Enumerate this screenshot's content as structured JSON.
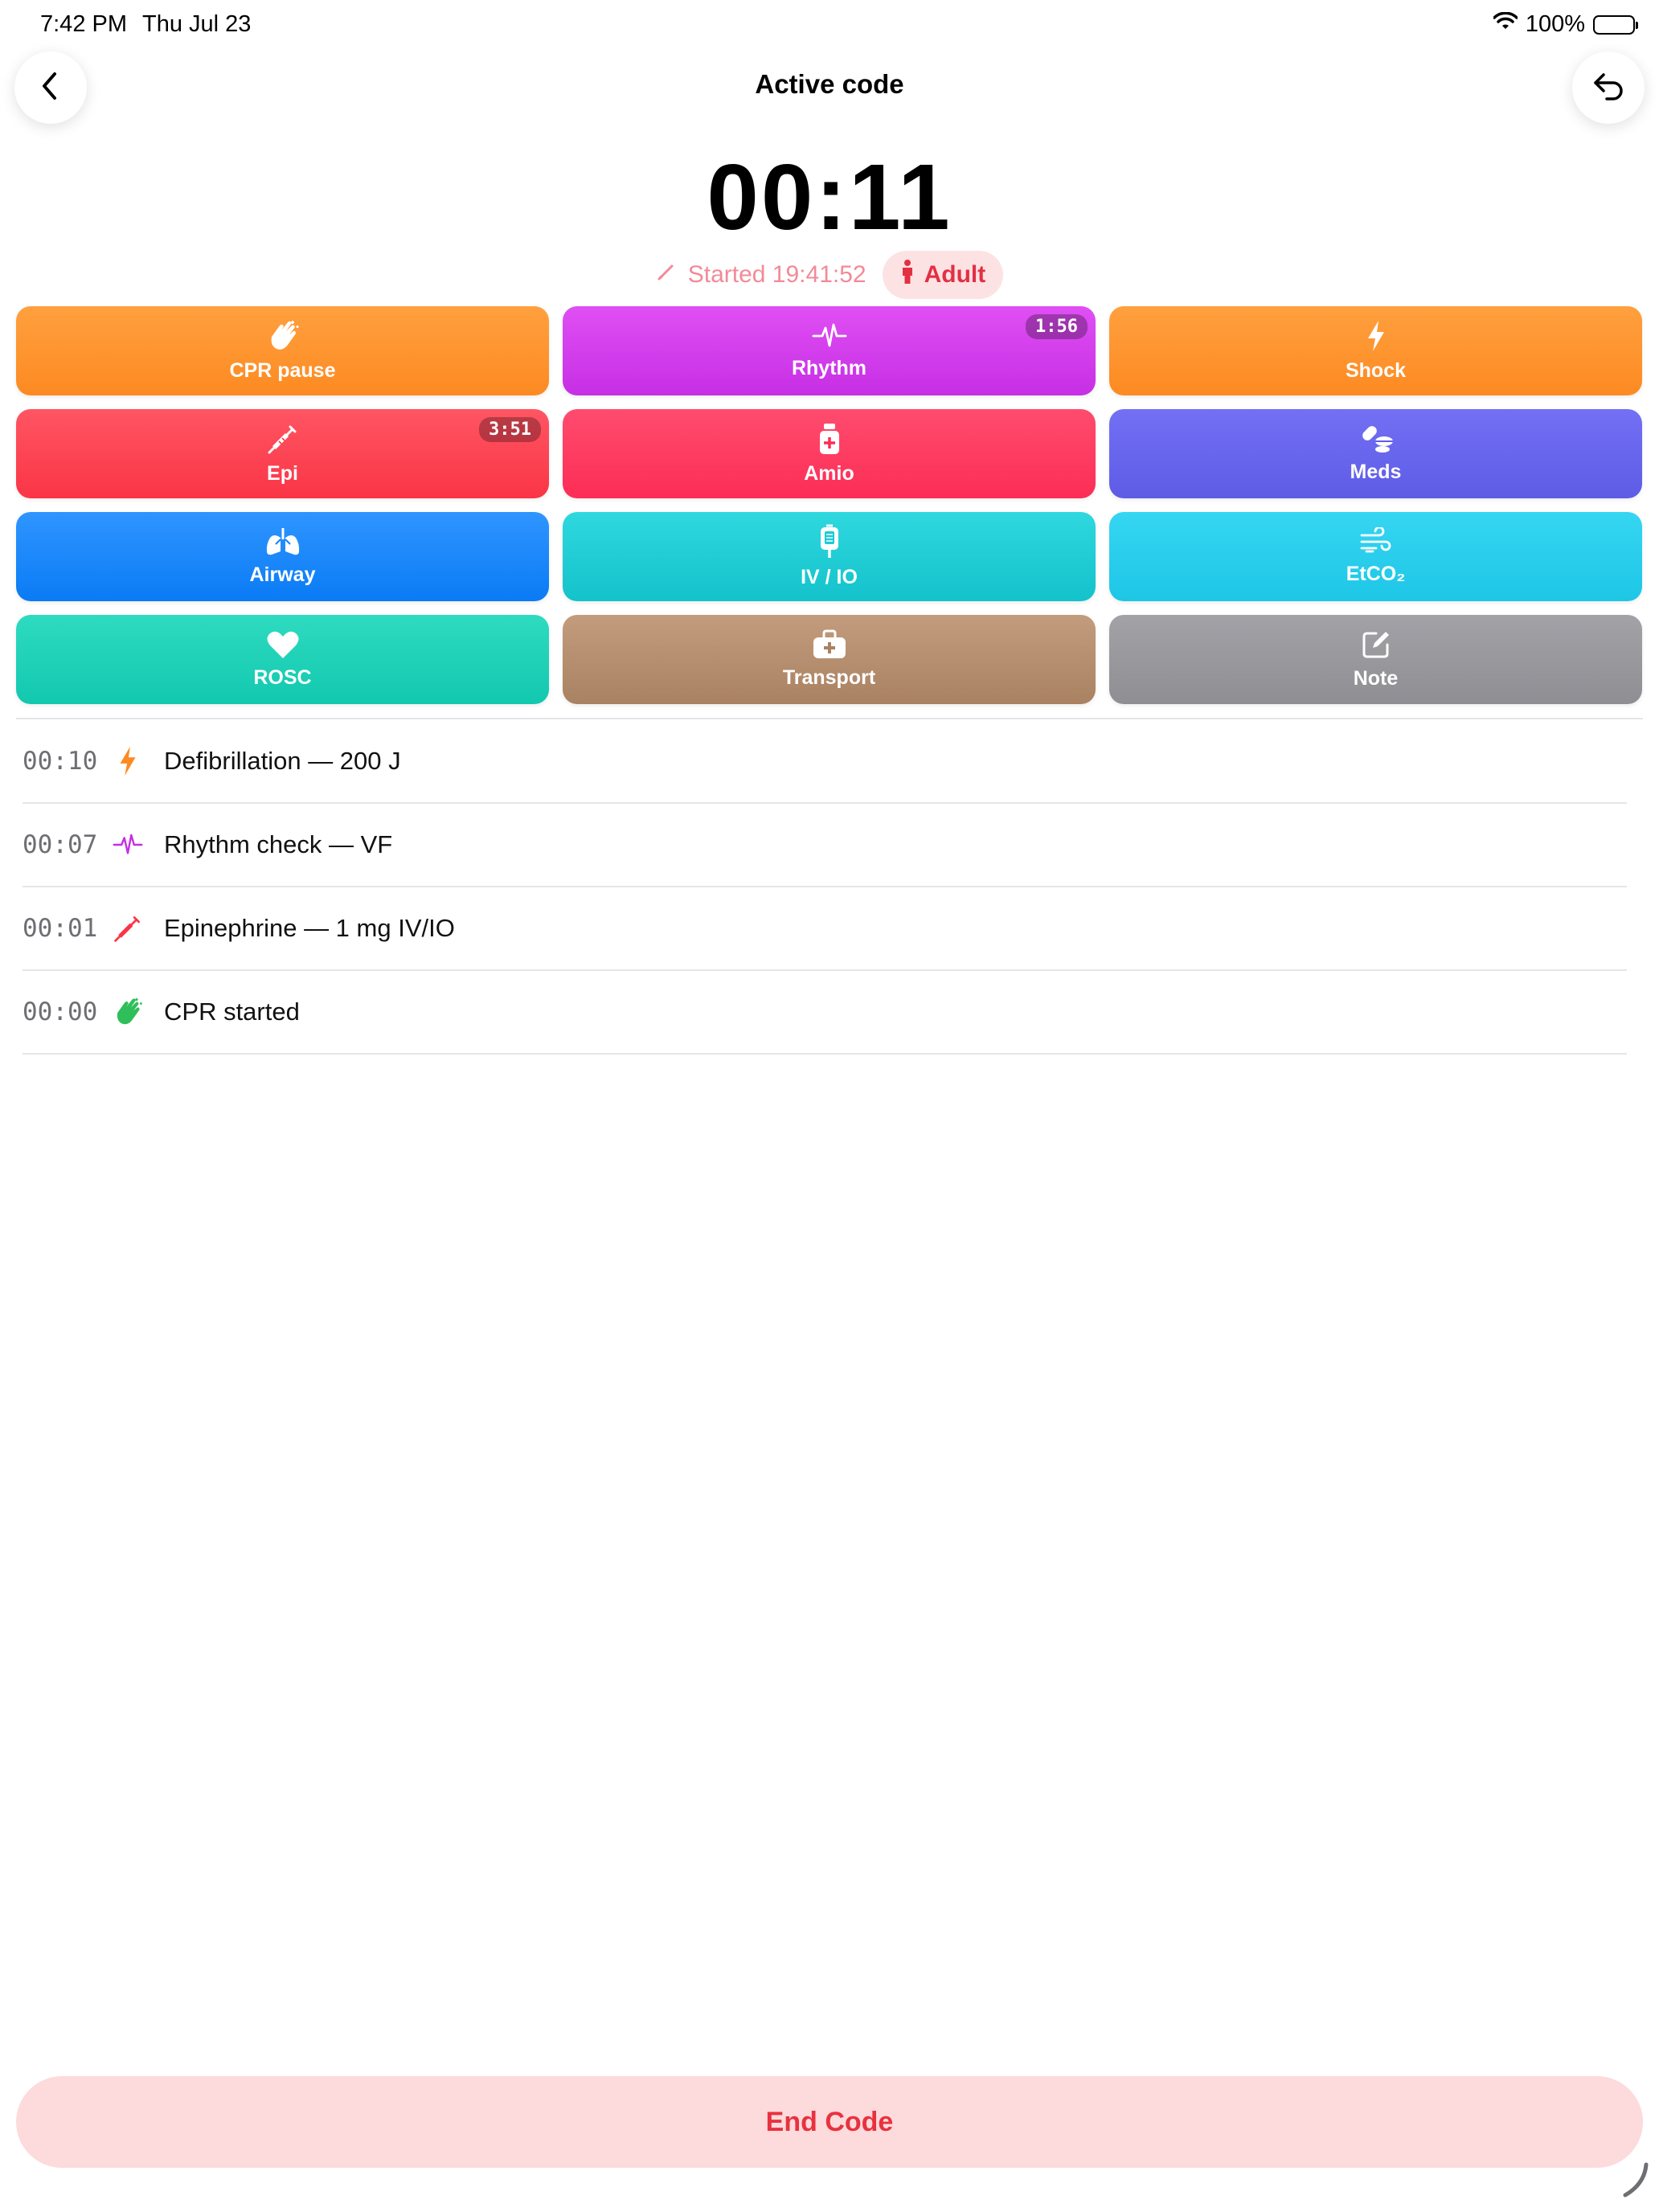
{
  "status_bar": {
    "time": "7:42 PM",
    "date": "Thu Jul 23",
    "battery": "100%"
  },
  "nav": {
    "title": "Active code",
    "back_icon": "chevron-left-icon",
    "undo_icon": "undo-arrow-icon"
  },
  "timer": {
    "elapsed": "00:11",
    "started": "Started 19:41:52",
    "patient": "Adult"
  },
  "actions": [
    {
      "label": "CPR pause",
      "icon": "hands-compress-icon"
    },
    {
      "label": "Rhythm",
      "icon": "waveform-icon",
      "badge": "1:56"
    },
    {
      "label": "Shock",
      "icon": "bolt-icon"
    },
    {
      "label": "Epi",
      "icon": "syringe-icon",
      "badge": "3:51"
    },
    {
      "label": "Amio",
      "icon": "medicine-bottle-icon"
    },
    {
      "label": "Meds",
      "icon": "pills-icon"
    },
    {
      "label": "Airway",
      "icon": "lungs-icon"
    },
    {
      "label": "IV / IO",
      "icon": "iv-bag-icon"
    },
    {
      "label": "EtCO₂",
      "icon": "wind-icon"
    },
    {
      "label": "ROSC",
      "icon": "heart-icon"
    },
    {
      "label": "Transport",
      "icon": "medical-bag-icon"
    },
    {
      "label": "Note",
      "icon": "note-edit-icon"
    }
  ],
  "colors": {
    "orange": "#fd8a22",
    "purple": "#c62fe4",
    "red": "#fa3546",
    "pink": "#fc2d56",
    "indigo": "#5e5ce6",
    "blue": "#0a84ff",
    "teal": "#1ccbd3",
    "cyan": "#1ec6e6",
    "mint": "#12c8af",
    "brown": "#a98262",
    "gray": "#8e8e93",
    "end_code_bg": "#fddadc",
    "end_code_text": "#e8323f"
  },
  "events": [
    {
      "time": "00:10",
      "text": "Defibrillation — 200 J",
      "icon": "bolt-icon",
      "color": "#fd8a22"
    },
    {
      "time": "00:07",
      "text": "Rhythm check — VF",
      "icon": "waveform-icon",
      "color": "#c62fe4"
    },
    {
      "time": "00:01",
      "text": "Epinephrine — 1 mg IV/IO",
      "icon": "syringe-icon",
      "color": "#fa3546"
    },
    {
      "time": "00:00",
      "text": "CPR started",
      "icon": "hands-compress-icon",
      "color": "#2fbf5a"
    }
  ],
  "end_button": {
    "label": "End Code"
  }
}
